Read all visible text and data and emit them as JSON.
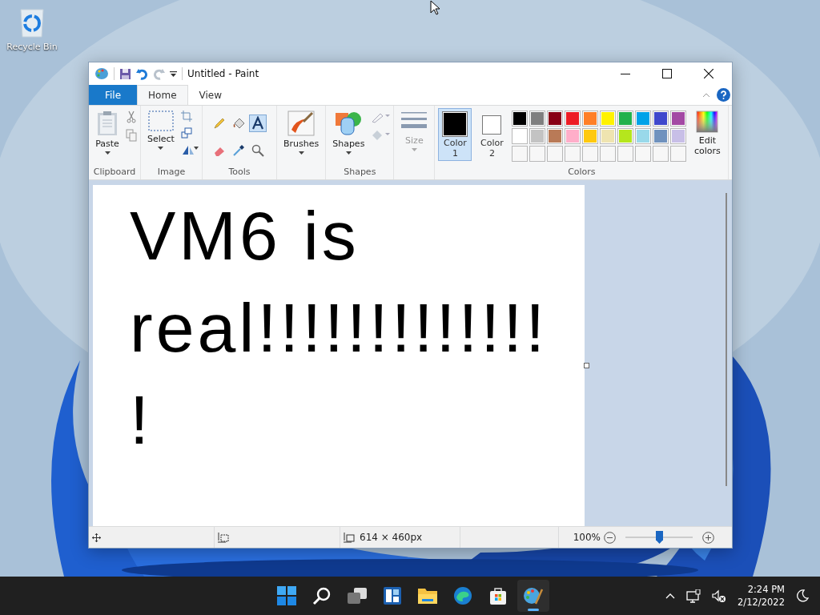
{
  "desktop": {
    "icons": [
      {
        "label": "Recycle Bin"
      }
    ]
  },
  "window": {
    "title": "Untitled - Paint"
  },
  "ribbon_tabs": [
    {
      "label": "File",
      "kind": "file",
      "selected": false
    },
    {
      "label": "Home",
      "kind": "tab",
      "selected": true
    },
    {
      "label": "View",
      "kind": "tab",
      "selected": false
    }
  ],
  "clipboard": {
    "label": "Clipboard",
    "paste": "Paste"
  },
  "image": {
    "label": "Image",
    "select": "Select"
  },
  "tools": {
    "label": "Tools",
    "items": [
      {
        "kind": "pencil",
        "selected": false
      },
      {
        "kind": "fill",
        "selected": false
      },
      {
        "kind": "text",
        "selected": true
      },
      {
        "kind": "eraser",
        "selected": false
      },
      {
        "kind": "picker",
        "selected": false
      },
      {
        "kind": "magnifier",
        "selected": false
      }
    ]
  },
  "brushes": {
    "label": "Brushes"
  },
  "shapes": {
    "label": "Shapes",
    "button": "Shapes"
  },
  "size": {
    "label": "Size",
    "disabled": true
  },
  "colors": {
    "label": "Colors",
    "color1": {
      "label": "Color 1",
      "color": "#000000",
      "selected": true
    },
    "color2": {
      "label": "Color 2",
      "color": "#ffffff",
      "selected": false
    },
    "palette": [
      {
        "color": "#000000"
      },
      {
        "color": "#7f7f7f"
      },
      {
        "color": "#880015"
      },
      {
        "color": "#ed1c24"
      },
      {
        "color": "#ff7f27"
      },
      {
        "color": "#fff200"
      },
      {
        "color": "#22b14c"
      },
      {
        "color": "#00a2e8"
      },
      {
        "color": "#3f48cc"
      },
      {
        "color": "#a349a4"
      },
      {
        "color": "#ffffff"
      },
      {
        "color": "#c3c3c3"
      },
      {
        "color": "#b97a57"
      },
      {
        "color": "#ffaec9"
      },
      {
        "color": "#ffc90e"
      },
      {
        "color": "#efe4b0"
      },
      {
        "color": "#b5e61d"
      },
      {
        "color": "#99d9ea"
      },
      {
        "color": "#7092be"
      },
      {
        "color": "#c8bfe7"
      }
    ],
    "edit": "Edit colors"
  },
  "canvas": {
    "lines": [
      "VM6 is",
      "real!!!!!!!!!!!!!",
      "!"
    ]
  },
  "status_bar": {
    "size": "614 × 460px",
    "zoom": "100%",
    "zoom_slider": {
      "level": 0.5
    }
  },
  "taskbar": {
    "apps": [
      {
        "kind": "start",
        "selected": false
      },
      {
        "kind": "search",
        "selected": false
      },
      {
        "kind": "taskview",
        "selected": false
      },
      {
        "kind": "widgets",
        "selected": false
      },
      {
        "kind": "explorer",
        "selected": false
      },
      {
        "kind": "edge",
        "selected": false
      },
      {
        "kind": "store",
        "selected": false
      },
      {
        "kind": "paint",
        "selected": true
      }
    ],
    "time": "2:24 PM",
    "date": "2/12/2022"
  }
}
